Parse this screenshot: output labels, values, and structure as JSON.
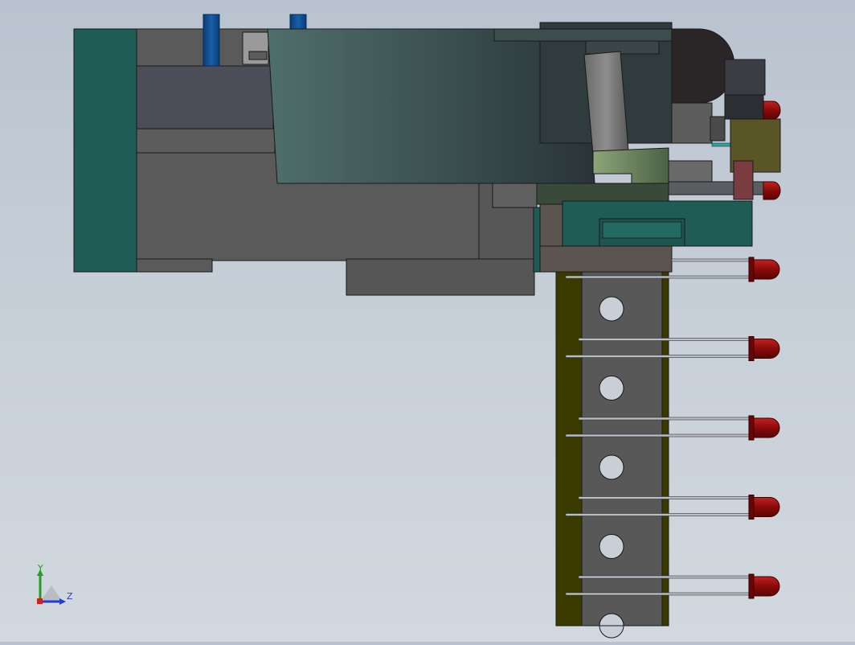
{
  "viewport": {
    "background_top": "#b9c3cf",
    "background_bottom": "#d2d8de"
  },
  "triad": {
    "y_label": "Y",
    "z_label": "Z",
    "y_color": "#1fa01f",
    "z_color": "#1f3fd0"
  },
  "model": {
    "led_color": "#8a0a0a",
    "tab_color": "#3a3a00",
    "teal_color": "#1f5c55",
    "plate_color": "#5a5a5a",
    "led_count": 6,
    "hole_count": 5
  }
}
